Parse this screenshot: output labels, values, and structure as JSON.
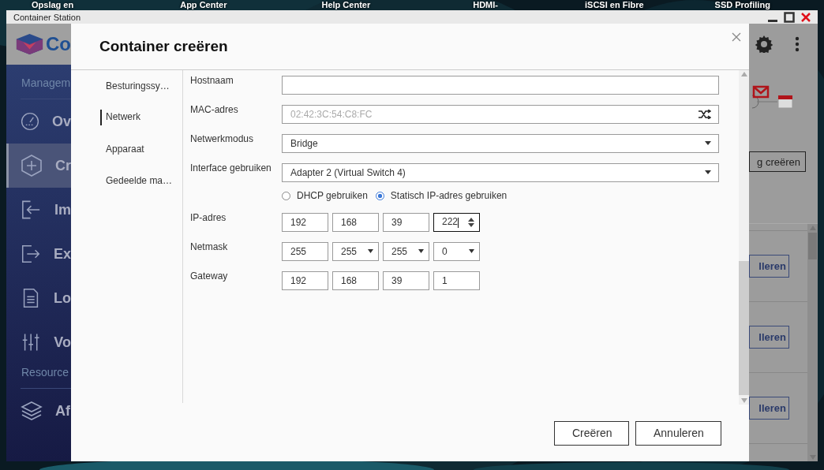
{
  "desktop_icons": [
    {
      "label": "Opslag en"
    },
    {
      "label": "App Center"
    },
    {
      "label": "Help Center"
    },
    {
      "label": "HDMI-"
    },
    {
      "label": "iSCSI en Fibre"
    },
    {
      "label": "SSD Profiling"
    }
  ],
  "window": {
    "title": "Container Station"
  },
  "app": {
    "title": "Co",
    "sidebar": [
      {
        "heading": "Managem",
        "items": [
          {
            "label": "Ov",
            "selected": false
          },
          {
            "label": "Cr",
            "selected": true
          },
          {
            "label": "Im",
            "selected": false
          },
          {
            "label": "Ex",
            "selected": false
          },
          {
            "label": "Lo",
            "selected": false
          },
          {
            "label": "Vo",
            "selected": false
          }
        ]
      },
      {
        "heading": "Resource",
        "items": [
          {
            "label": "Af",
            "selected": false
          }
        ]
      }
    ],
    "create_button": "g creëren",
    "list_buttons": [
      "lleren",
      "lleren",
      "lleren"
    ]
  },
  "dialog": {
    "title": "Container creëren",
    "nav": [
      {
        "label": "Besturingssy…",
        "selected": false
      },
      {
        "label": "Netwerk",
        "selected": true
      },
      {
        "label": "Apparaat",
        "selected": false
      },
      {
        "label": "Gedeelde ma…",
        "selected": false
      }
    ],
    "fields": [
      {
        "kind": "text",
        "label": "Hostnaam"
      },
      {
        "kind": "mac",
        "label": "MAC-adres",
        "placeholder": "02:42:3C:54:C8:FC"
      },
      {
        "kind": "select",
        "label": "Netwerkmodus",
        "value": "Bridge"
      },
      {
        "kind": "select",
        "label": "Interface gebruiken",
        "value": "Adapter 2 (Virtual Switch 4)"
      }
    ],
    "radios": [
      {
        "label": "DHCP gebruiken",
        "selected": false
      },
      {
        "label": "Statisch IP-adres gebruiken",
        "selected": true
      }
    ],
    "addresses": [
      {
        "label": "IP-adres",
        "octets": [
          {
            "kind": "text",
            "value": "192"
          },
          {
            "kind": "text",
            "value": "168"
          },
          {
            "kind": "text",
            "value": "39"
          },
          {
            "kind": "spin",
            "value": "222",
            "focused": true
          }
        ]
      },
      {
        "label": "Netmask",
        "octets": [
          {
            "kind": "text",
            "value": "255"
          },
          {
            "kind": "select",
            "value": "255"
          },
          {
            "kind": "select",
            "value": "255"
          },
          {
            "kind": "select",
            "value": "0"
          }
        ]
      },
      {
        "label": "Gateway",
        "octets": [
          {
            "kind": "text",
            "value": "192"
          },
          {
            "kind": "text",
            "value": "168"
          },
          {
            "kind": "text",
            "value": "39"
          },
          {
            "kind": "text",
            "value": "1"
          }
        ]
      }
    ],
    "buttons": [
      "Creëren",
      "Annuleren"
    ]
  }
}
